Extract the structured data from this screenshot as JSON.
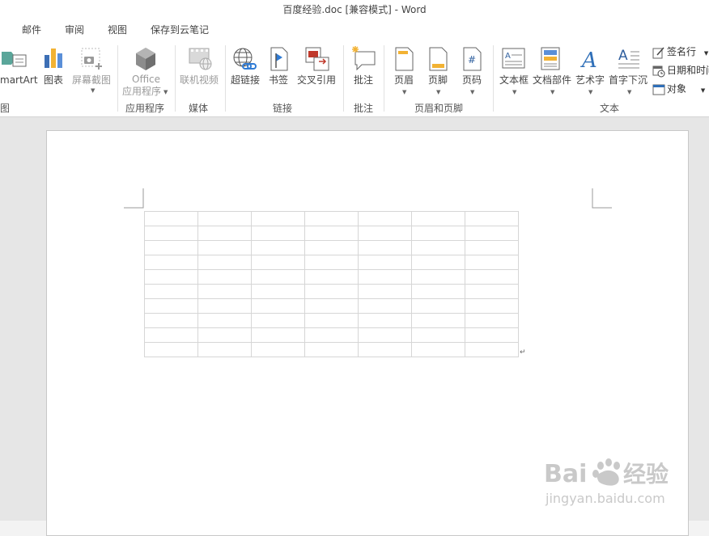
{
  "window": {
    "title": "百度经验.doc [兼容模式] - Word"
  },
  "menu": [
    "邮件",
    "审阅",
    "视图",
    "保存到云笔记"
  ],
  "ribbon": {
    "buttons": {
      "smartart": "martArt",
      "chart": "图表",
      "screenshot": "屏幕截图",
      "office_apps_line1": "Office",
      "office_apps_line2": "应用程序",
      "online_video": "联机视频",
      "hyperlink": "超链接",
      "bookmark": "书签",
      "cross_ref": "交叉引用",
      "comment": "批注",
      "header": "页眉",
      "footer": "页脚",
      "page_number": "页码",
      "textbox": "文本框",
      "quick_parts": "文档部件",
      "wordart": "艺术字",
      "dropcap": "首字下沉",
      "signature_line": "签名行",
      "date_time": "日期和时间",
      "object": "对象"
    },
    "groups": {
      "illustrations": "图",
      "apps": "应用程序",
      "media": "媒体",
      "links": "链接",
      "comments": "批注",
      "header_footer": "页眉和页脚",
      "text": "文本"
    }
  },
  "document": {
    "table": {
      "rows": 10,
      "cols": 7
    }
  },
  "watermark": {
    "brand": "Baidu",
    "brand_cn": "经验",
    "url": "jingyan.baidu.com"
  }
}
